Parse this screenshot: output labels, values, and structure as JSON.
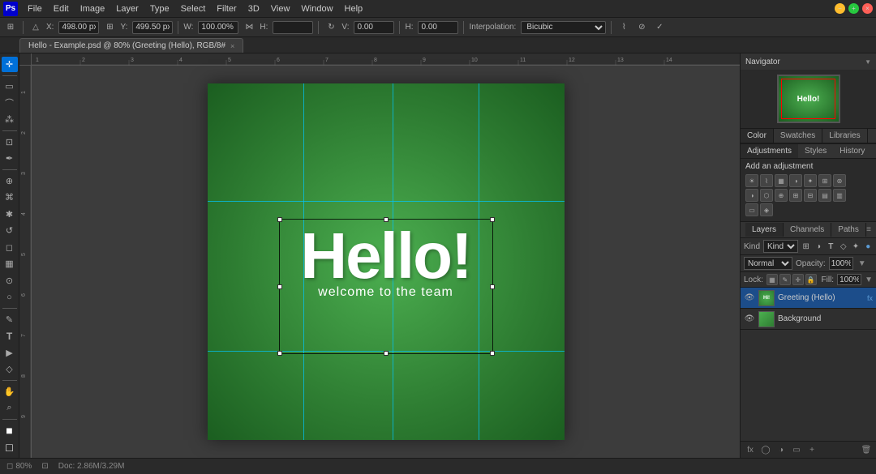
{
  "app": {
    "title": "Adobe Photoshop",
    "icon_label": "Ps"
  },
  "menu": {
    "items": [
      "Ps",
      "File",
      "Edit",
      "Image",
      "Layer",
      "Type",
      "Select",
      "Filter",
      "3D",
      "View",
      "Window",
      "Help"
    ]
  },
  "window_controls": {
    "minimize": "−",
    "maximize": "+",
    "close": "×"
  },
  "toolbar": {
    "x_label": "X:",
    "x_value": "498.00 px",
    "y_label": "Y:",
    "y_value": "499.50 px",
    "w_label": "W:",
    "w_value": "100.00%",
    "h_label": "H:",
    "h_value": "0.00",
    "v_label": "V:",
    "v_value": "0.00",
    "interpolation_label": "Interpolation:",
    "interpolation_value": "Bicubic",
    "check_icon": "✓",
    "cancel_icon": "⊘"
  },
  "tab": {
    "label": "Hello - Example.psd @ 80% (Greeting (Hello), RGB/8#",
    "close": "×"
  },
  "canvas": {
    "hello_text": "Hello!",
    "welcome_text": "welcome to the team"
  },
  "navigator": {
    "label": "Navigator",
    "preview_text": "Hello!"
  },
  "color_panel": {
    "tabs": [
      "Color",
      "Swatches",
      "Libraries"
    ]
  },
  "adjustments_panel": {
    "tabs": [
      "Adjustments",
      "Styles",
      "History"
    ],
    "title": "Add an adjustment"
  },
  "layers_panel": {
    "tabs": [
      "Layers",
      "Channels",
      "Paths"
    ],
    "kind_label": "Kind",
    "blend_mode": "Normal",
    "opacity_label": "Opacity:",
    "opacity_value": "100%",
    "lock_label": "Lock:",
    "fill_label": "Fill:",
    "fill_value": "100%",
    "layers": [
      {
        "name": "Greeting (Hello)",
        "type": "text",
        "visible": true,
        "has_fx": true,
        "fx_label": "fx"
      },
      {
        "name": "Background",
        "type": "solid",
        "visible": true,
        "has_fx": false
      }
    ]
  },
  "status_bar": {
    "zoom": "80%",
    "zoom_icon": "◻",
    "doc_size": "Doc: 2.86M/3.29M"
  },
  "tools": [
    {
      "name": "move",
      "icon": "✛"
    },
    {
      "name": "marquee",
      "icon": "▭"
    },
    {
      "name": "lasso",
      "icon": "⌒"
    },
    {
      "name": "magic-wand",
      "icon": "⁂"
    },
    {
      "name": "crop",
      "icon": "⊡"
    },
    {
      "name": "eyedropper",
      "icon": "✒"
    },
    {
      "name": "healing",
      "icon": "⊕"
    },
    {
      "name": "brush",
      "icon": "⌘"
    },
    {
      "name": "clone-stamp",
      "icon": "✱"
    },
    {
      "name": "history-brush",
      "icon": "↺"
    },
    {
      "name": "eraser",
      "icon": "◻"
    },
    {
      "name": "gradient",
      "icon": "▦"
    },
    {
      "name": "blur",
      "icon": "⊙"
    },
    {
      "name": "dodge",
      "icon": "○"
    },
    {
      "name": "pen",
      "icon": "✎"
    },
    {
      "name": "type",
      "icon": "T"
    },
    {
      "name": "path-selection",
      "icon": "▶"
    },
    {
      "name": "shape",
      "icon": "◇"
    },
    {
      "name": "hand",
      "icon": "✋"
    },
    {
      "name": "zoom",
      "icon": "⌕"
    },
    {
      "name": "foreground-color",
      "icon": "■"
    },
    {
      "name": "background-color",
      "icon": "□"
    }
  ]
}
